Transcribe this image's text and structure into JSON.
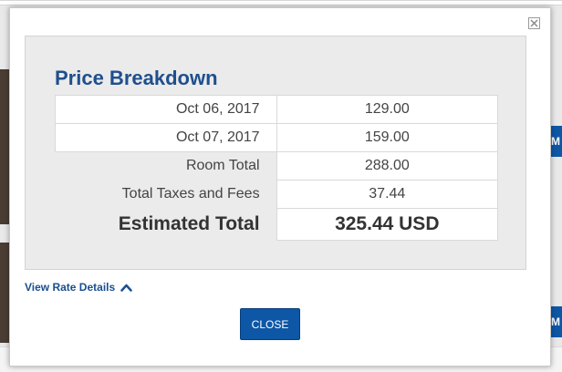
{
  "modal": {
    "title": "Price Breakdown",
    "rows": [
      {
        "label": "Oct 06, 2017",
        "value": "129.00"
      },
      {
        "label": "Oct 07, 2017",
        "value": "159.00"
      },
      {
        "label": "Room Total",
        "value": "288.00"
      },
      {
        "label": "Total Taxes and Fees",
        "value": "37.44"
      }
    ],
    "total": {
      "label": "Estimated Total",
      "value": "325.44 USD"
    },
    "rate_link": "View Rate Details",
    "close_label": "CLOSE"
  },
  "background": {
    "right_button_text": "M"
  },
  "colors": {
    "accent": "#0e57a6",
    "title": "#1f4f8d",
    "panel_bg": "#ebebeb"
  }
}
